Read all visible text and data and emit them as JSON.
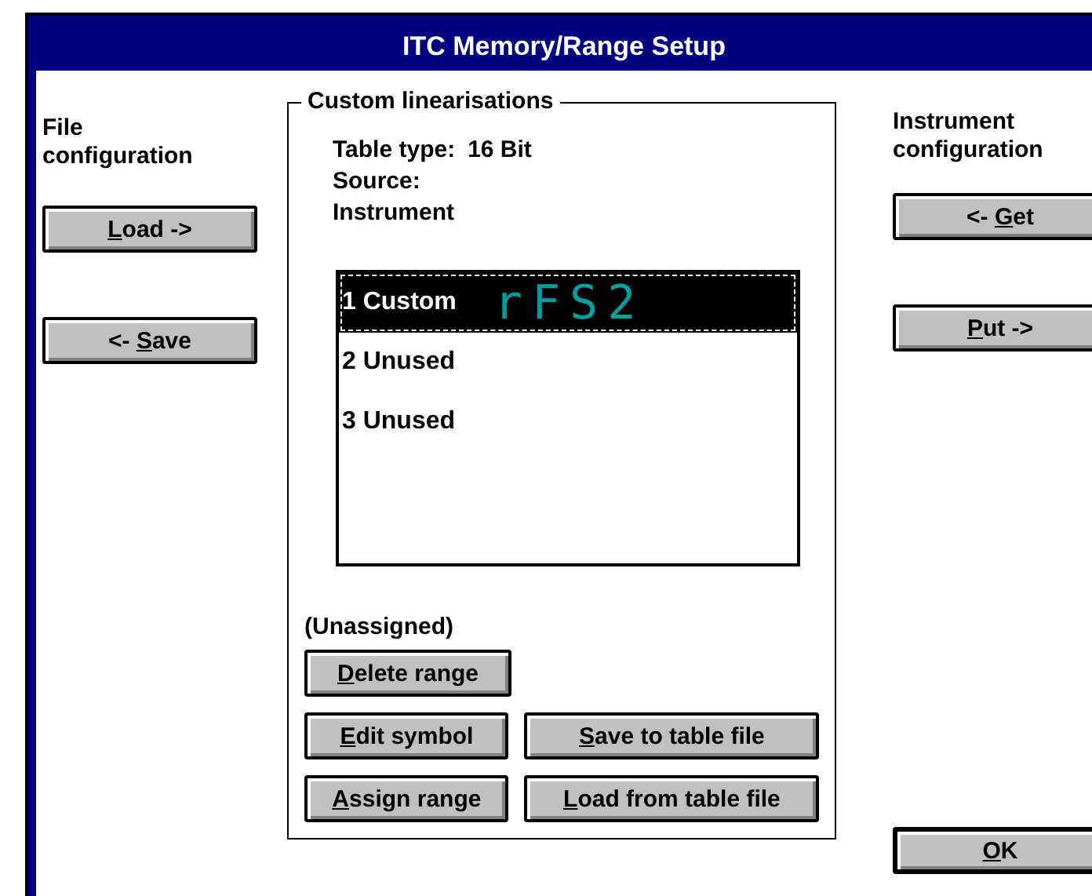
{
  "window": {
    "title": "ITC Memory/Range Setup"
  },
  "file_configuration": {
    "heading": "File configuration",
    "buttons": [
      {
        "key": "L",
        "post": "oad ->"
      },
      {
        "pre": "<- ",
        "key": "S",
        "post": "ave"
      }
    ]
  },
  "custom_linearisations": {
    "title": "Custom linearisations",
    "table_type_label": "Table type:",
    "table_type_value": "16 Bit",
    "source_label": "Source:",
    "source_value": "Instrument",
    "list": [
      {
        "label": "1 Custom",
        "symbol": "rFS2",
        "selected": true
      },
      {
        "label": "2 Unused",
        "selected": false
      },
      {
        "label": "3 Unused",
        "selected": false
      }
    ],
    "assignment": "(Unassigned)",
    "buttons": [
      [
        {
          "key": "D",
          "post": "elete range"
        }
      ],
      [
        {
          "key": "E",
          "post": "dit symbol"
        },
        {
          "key": "S",
          "post": "ave to table file"
        }
      ],
      [
        {
          "key": "A",
          "post": "ssign range"
        },
        {
          "key": "L",
          "post": "oad from table file"
        }
      ]
    ]
  },
  "instrument_configuration": {
    "heading": "Instrument configuration",
    "buttons": [
      {
        "pre": "<- ",
        "key": "G",
        "post": "et"
      },
      {
        "key": "P",
        "post": "ut ->"
      }
    ]
  },
  "ok_button": {
    "key": "O",
    "post": "K",
    "default": true
  }
}
